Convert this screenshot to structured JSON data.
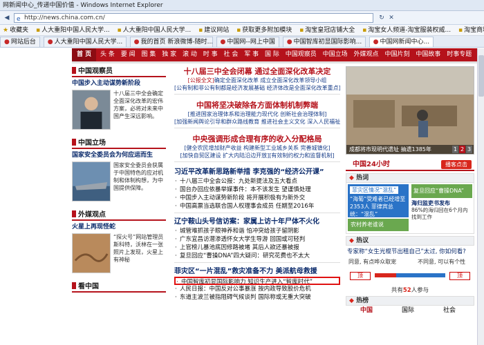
{
  "window": {
    "title": "网新闻中心_传递中国价值 - Windows Internet Explorer"
  },
  "address": {
    "url": "http://news.china.com.cn/"
  },
  "favorites": [
    {
      "label": "收藏夹"
    },
    {
      "label": "人大重阳中国人民大学..."
    },
    {
      "label": "人大重阳中国人民大学..."
    },
    {
      "label": "建议网站"
    },
    {
      "label": "获取更多附加模块"
    },
    {
      "label": "淘宝皇冠店铺大全"
    },
    {
      "label": "淘宝女人频道-淘宝服装权威..."
    },
    {
      "label": "淘宝商城 - 品牌正品 商城..."
    }
  ],
  "browser_tabs": [
    {
      "label": "网站后台"
    },
    {
      "label": "人大重阳中国人民大学..."
    },
    {
      "label": "我的首页 新浪微博-随时..."
    },
    {
      "label": "中国网--网上中国"
    },
    {
      "label": "中国智库初显国际影响..."
    },
    {
      "label": "中国网新闻中心..."
    }
  ],
  "sitenav": {
    "home": "首 页",
    "items": [
      "头 条",
      "要 闻",
      "图 集",
      "独 家",
      "滚 动",
      "时 事",
      "社 会",
      "军 事",
      "国 际",
      "中国观察员",
      "中国立场",
      "外媒观点",
      "中国片刻",
      "中国故事",
      "时事专题"
    ]
  },
  "left": {
    "observer": {
      "title": "中国观察员",
      "lead": "中国步入主动谋势新阶段",
      "desc": "十八届三中全会确定全面深化改革的宏伟方案，必将对未来中国产生深远影响。"
    },
    "stance": {
      "title": "中国立场",
      "lead": "国家安全委员会为何应运而生",
      "desc": "国家安全委员会获属于中国特色的应对机制和体制构想，为中国提供保障。"
    },
    "foreign": {
      "title": "外媒观点",
      "lead": "火星上再现怪蛇",
      "desc": "“探火号”网站管理员斯科特，沃林在一张照片上发现，火星上有神秘"
    },
    "watch": {
      "title": "看中国"
    }
  },
  "main": {
    "headline1": "十八届三中全会闭幕 通过全面深化改革决定",
    "sub1a_tag": "[公报全文]",
    "sub1a": "确定全面深化改革 成立全面深化改革领导小组",
    "sub1b": "[公有制和非公有制都是经济发展基础 经济体改是全面深化改革重点]",
    "headline2": "中国将坚决破除各方面体制机制弊端",
    "sub2a": "[推进国家治理体系和治理能力现代化 创新社会治理体制]",
    "sub2b": "[加强新闻舆论引导和群众路线教育 推进社会主义文化 深入人民福祉]",
    "headline3": "中央强调形成合理有序的收入分配格局",
    "sub3a": "[健全农民增加财产收益 构建新型工业城乡关系 完善城镇化]",
    "sub3b": "[加快自贸区建设 扩大内陆沿边开放][有效制约权力和监督机制]",
    "sec1": "习近平改革新思路新举措 李克强的“经济公开课”",
    "sec1_items": [
      "十八届三中全会公报：九处新提法及五大看点",
      "国台办回应依暴举媒事件：本不该发生 望谨慎处理",
      "中国步入主动谋势新阶段 将开展积极有为新外交",
      "中国高票当选联合国人权理事会成员 任期至2016年"
    ],
    "sec2": "辽宁鞍山头号信访案：家属上访十年尸体不火化",
    "sec2_items": [
      "城管难抓孩子眼神养和谐 怕冲突给孩子留阴影",
      "广东宜昌访潜渗透怀女大学生导游 回国或可轻判",
      "上官榜儿暴池底因修路被堵 其后人欲还暴被报",
      "复旦回应“曹操DNA”四大疑问：研究花费也不太大"
    ],
    "sec3": "菲灾区“一片混乱”救灾准备不力 美派航母救援",
    "sec3_highlight": "中国智库初显国际影响力 知识生产进入“智库时代”",
    "sec3_items": [
      "人民日报：中国反对公事暴涨 按内政导致股价危机",
      "东道主波兰被指阻碍气候谈判 国际称或无重大突破"
    ]
  },
  "right": {
    "photo_caption": "成都将市现明代遗址 抽遗1385年",
    "pages": [
      "1",
      "2",
      "3"
    ],
    "news24": {
      "title": "中国24小时",
      "button": "播客点击"
    },
    "hot": {
      "title": "热词",
      "card_head": "菲灾区情况“混乱”",
      "card_body": "“海葡”受难者已经增至2353人 菲律宾总统：“混乱”",
      "green": "农村养老谁说",
      "rl1": "复旦回应“曹操DNA”",
      "rl2": "海归监吏书发布",
      "rl_text": "86%的海归回在6个月内找到工作"
    },
    "poll": {
      "title": "热议",
      "question": "专家称“女生光棍节出租自己”太过, 你如何看?",
      "opt_left": "同意, 有点哗众取宠",
      "opt_right": "不同意, 可以有个性",
      "vote_label": "顶",
      "agree_share": 0.3,
      "count_prefix": "共有",
      "count": "52",
      "count_suffix": "人参与"
    },
    "rank": {
      "title": "热榜",
      "tabs": [
        "中国",
        "国际",
        "社会"
      ]
    }
  }
}
